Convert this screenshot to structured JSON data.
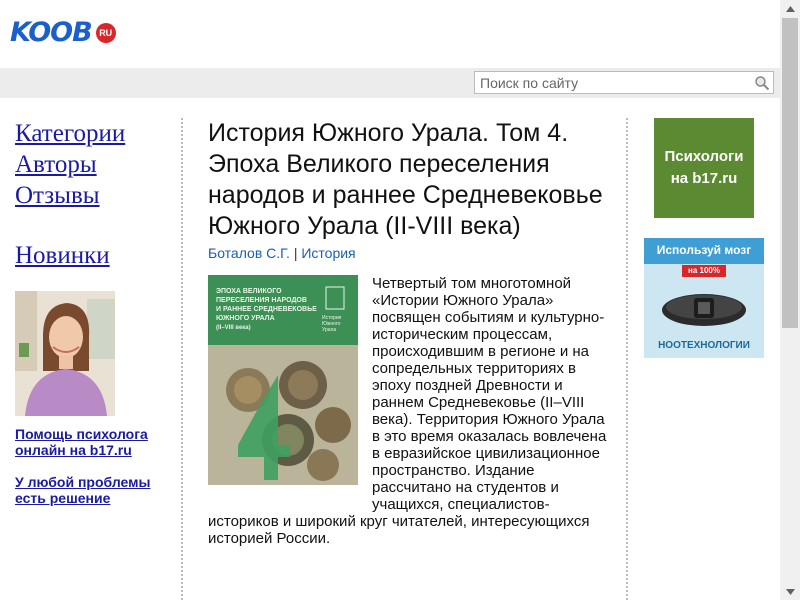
{
  "site": {
    "logo": "KOOB",
    "logo_badge": "RU"
  },
  "search": {
    "placeholder": "Поиск по сайту"
  },
  "nav": {
    "items": [
      {
        "label": "Категории"
      },
      {
        "label": "Авторы"
      },
      {
        "label": "Отзывы"
      }
    ],
    "new_label": "Новинки"
  },
  "promos": [
    {
      "label": "Помощь психолога онлайн на b17.ru"
    },
    {
      "label": "У любой проблемы есть решение"
    }
  ],
  "book": {
    "title": "История Южного Урала. Том 4. Эпоха Великого переселения народов и раннее Средневековье Южного Урала (II-VIII века)",
    "author": "Боталов С.Г.",
    "separator": "|",
    "category": "История",
    "cover_text": "ЭПОХА ВЕЛИКОГО ПЕРЕСЕЛЕНИЯ НАРОДОВ И РАННЕЕ СРЕДНЕВЕКОВЬЕ ЮЖНОГО УРАЛА (II–VIII века)",
    "cover_series": "История Южного Урала",
    "cover_number": "4",
    "description": "Четвертый том многотомной «Истории Южного Урала» посвящен событиям и культурно-историческим процессам, происходившим в регионе и на сопредельных территориях в эпоху поздней Древности и раннем Средневековье (II–VIII века). Территория Южного Урала в это время оказалась вовлечена в евразийское цивилизационное пространство. Издание рассчитано на студентов и учащихся, специалистов-историков и широкий круг читателей, интересующихся историей России."
  },
  "ads": [
    {
      "line1": "Психологи",
      "line2": "на b17.ru"
    },
    {
      "headline": "Используй мозг",
      "badge": "на 100%",
      "brand": "НООТЕХНОЛОГИИ"
    }
  ],
  "colors": {
    "link": "#1a1aa6",
    "logo": "#1a5fcc",
    "ad_green": "#5b8a33",
    "cover_green": "#3f9a5a"
  }
}
